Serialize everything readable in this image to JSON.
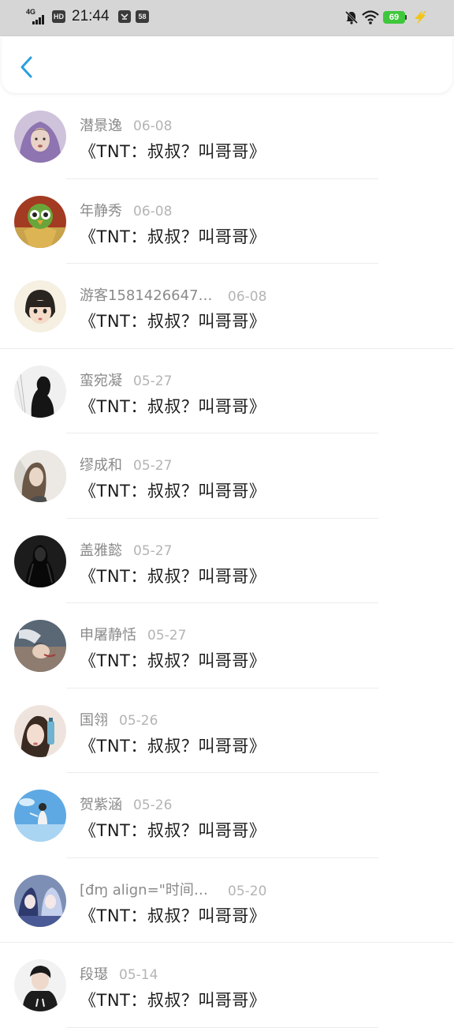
{
  "status_bar": {
    "network": "4G",
    "hd_label": "HD",
    "time": "21:44",
    "notification_count": "58",
    "battery": "69"
  },
  "header": {
    "back_icon": "chevron-left-icon",
    "accent_color": "#2a9fe0"
  },
  "messages": [
    {
      "name": "潜景逸",
      "date": "06-08",
      "title": "《TNT：叔叔？叫哥哥》"
    },
    {
      "name": "年静秀",
      "date": "06-08",
      "title": "《TNT：叔叔？叫哥哥》"
    },
    {
      "name": "游客1581426647…",
      "date": "06-08",
      "title": "《TNT：叔叔？叫哥哥》"
    },
    {
      "name": "蛮宛凝",
      "date": "05-27",
      "title": "《TNT：叔叔？叫哥哥》"
    },
    {
      "name": "缪成和",
      "date": "05-27",
      "title": "《TNT：叔叔？叫哥哥》"
    },
    {
      "name": "盖雅懿",
      "date": "05-27",
      "title": "《TNT：叔叔？叫哥哥》"
    },
    {
      "name": "申屠静恬",
      "date": "05-27",
      "title": "《TNT：叔叔？叫哥哥》"
    },
    {
      "name": "国翎",
      "date": "05-26",
      "title": "《TNT：叔叔？叫哥哥》"
    },
    {
      "name": "贺紫涵",
      "date": "05-26",
      "title": "《TNT：叔叔？叫哥哥》"
    },
    {
      "name": "[đɱ  align=\"时间…",
      "date": "05-20",
      "title": "《TNT：叔叔？叫哥哥》"
    },
    {
      "name": "段璱",
      "date": "05-14",
      "title": "《TNT：叔叔？叫哥哥》"
    }
  ]
}
